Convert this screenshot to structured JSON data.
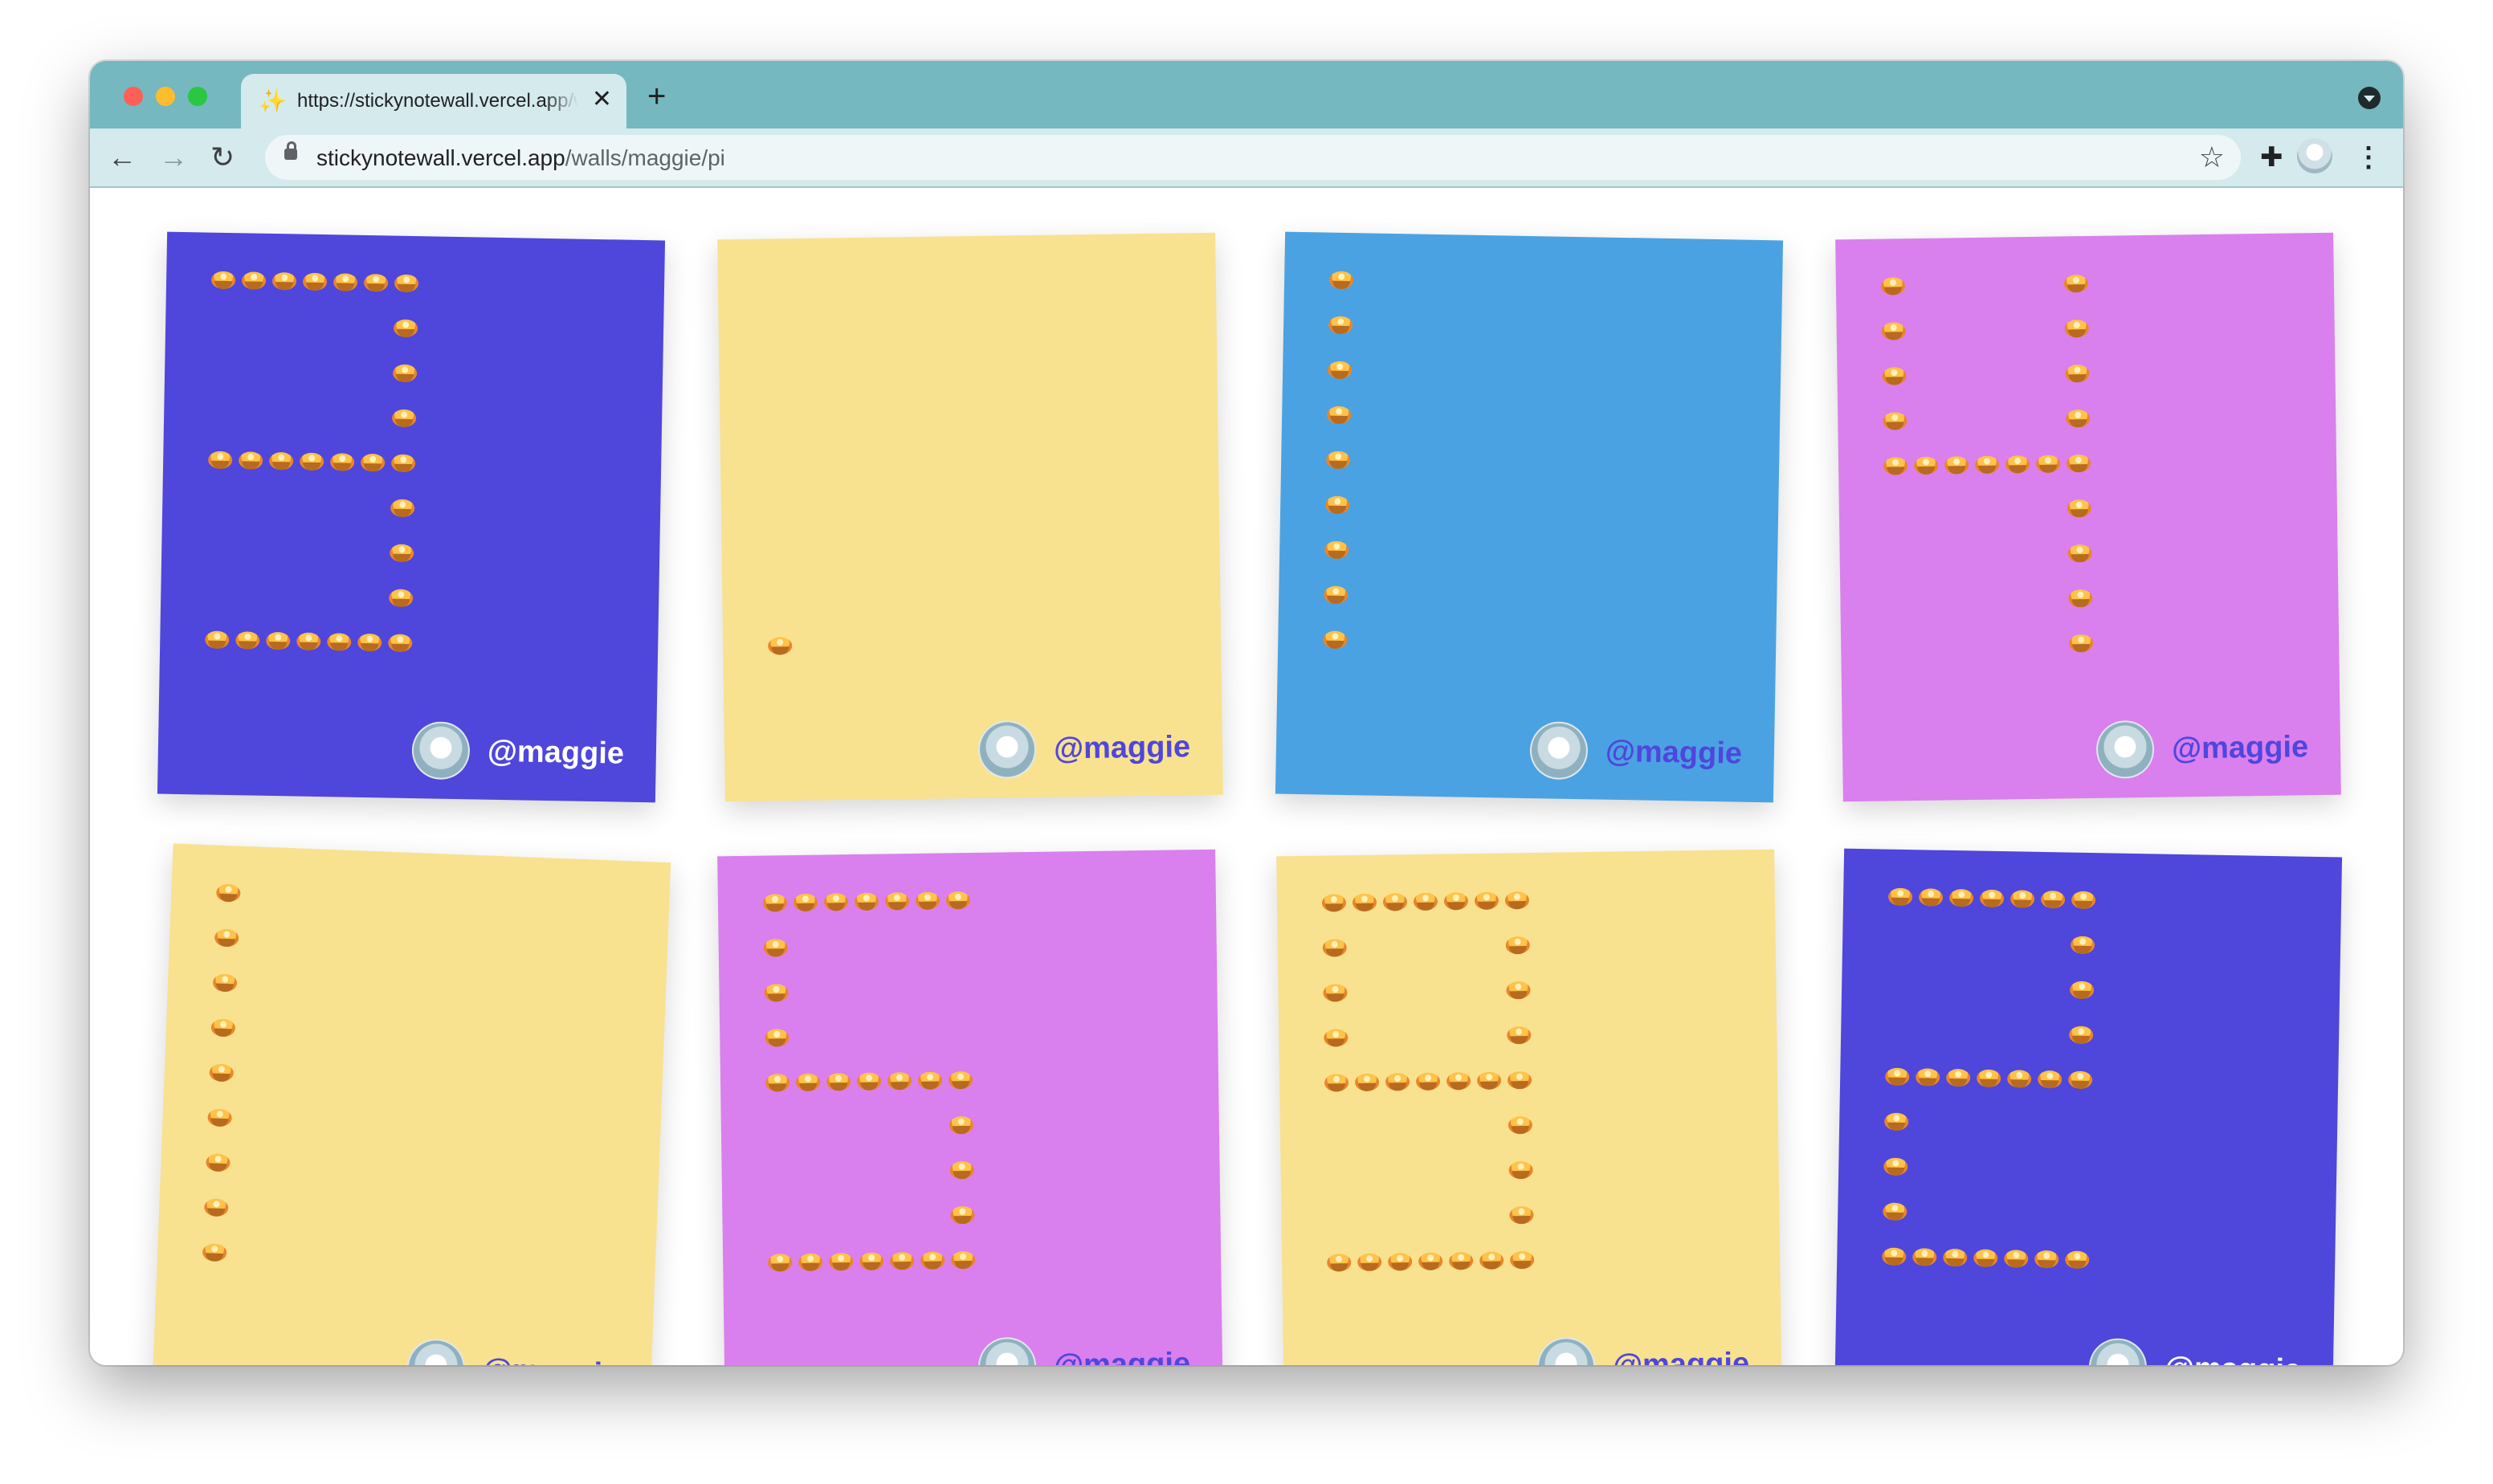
{
  "browser": {
    "tab": {
      "title": "https://stickynotewall.vercel.app/walls/maggie/pi",
      "favicon": "sparkles-icon",
      "close_glyph": "✕"
    },
    "new_tab_glyph": "+",
    "nav": {
      "back": "←",
      "forward": "→",
      "reload": "↻"
    },
    "address": {
      "host": "stickynotewall.vercel.app",
      "path": "/walls/maggie/pi"
    },
    "bookmark_glyph": "☆",
    "extensions_glyph": "✚",
    "menu_glyph": "⋮",
    "colors": {
      "frame": "#75b8bf",
      "toolbar": "#d4eaed"
    }
  },
  "wall": {
    "emoji": "pie-emoji",
    "notes": [
      {
        "digit": "3",
        "color": "#4f46dc",
        "author": "@maggie",
        "author_color": "#ffffff"
      },
      {
        "digit": ".",
        "color": "#f8e290",
        "author": "@maggie",
        "author_color": "#4f46dc"
      },
      {
        "digit": "1",
        "color": "#4aa2e2",
        "author": "@maggie",
        "author_color": "#4f46dc"
      },
      {
        "digit": "4",
        "color": "#da7fee",
        "author": "@maggie",
        "author_color": "#4f46dc"
      },
      {
        "digit": "1",
        "color": "#f8e290",
        "author": "@maggie",
        "author_color": "#4f46dc"
      },
      {
        "digit": "5",
        "color": "#da7fee",
        "author": "@maggie",
        "author_color": "#4f46dc"
      },
      {
        "digit": "9",
        "color": "#f8e290",
        "author": "@maggie",
        "author_color": "#4f46dc"
      },
      {
        "digit": "2",
        "color": "#4f46dc",
        "author": "@maggie",
        "author_color": "#ffffff"
      }
    ]
  }
}
